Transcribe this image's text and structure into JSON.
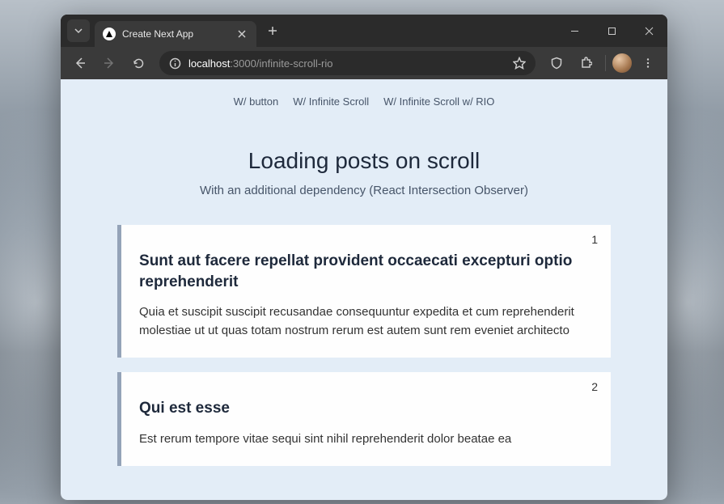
{
  "browser": {
    "tab_title": "Create Next App",
    "url": {
      "host": "localhost",
      "port": ":3000",
      "path": "/infinite-scroll-rio"
    }
  },
  "nav": {
    "links": [
      "W/ button",
      "W/ Infinite Scroll",
      "W/ Infinite Scroll w/ RIO"
    ]
  },
  "page": {
    "title": "Loading posts on scroll",
    "subtitle": "With an additional dependency (React Intersection Observer)"
  },
  "posts": [
    {
      "number": "1",
      "title": "Sunt aut facere repellat provident occaecati excepturi optio reprehenderit",
      "body": "Quia et suscipit suscipit recusandae consequuntur expedita et cum reprehenderit molestiae ut ut quas totam nostrum rerum est autem sunt rem eveniet architecto"
    },
    {
      "number": "2",
      "title": "Qui est esse",
      "body": "Est rerum tempore vitae sequi sint nihil reprehenderit dolor beatae ea"
    }
  ]
}
